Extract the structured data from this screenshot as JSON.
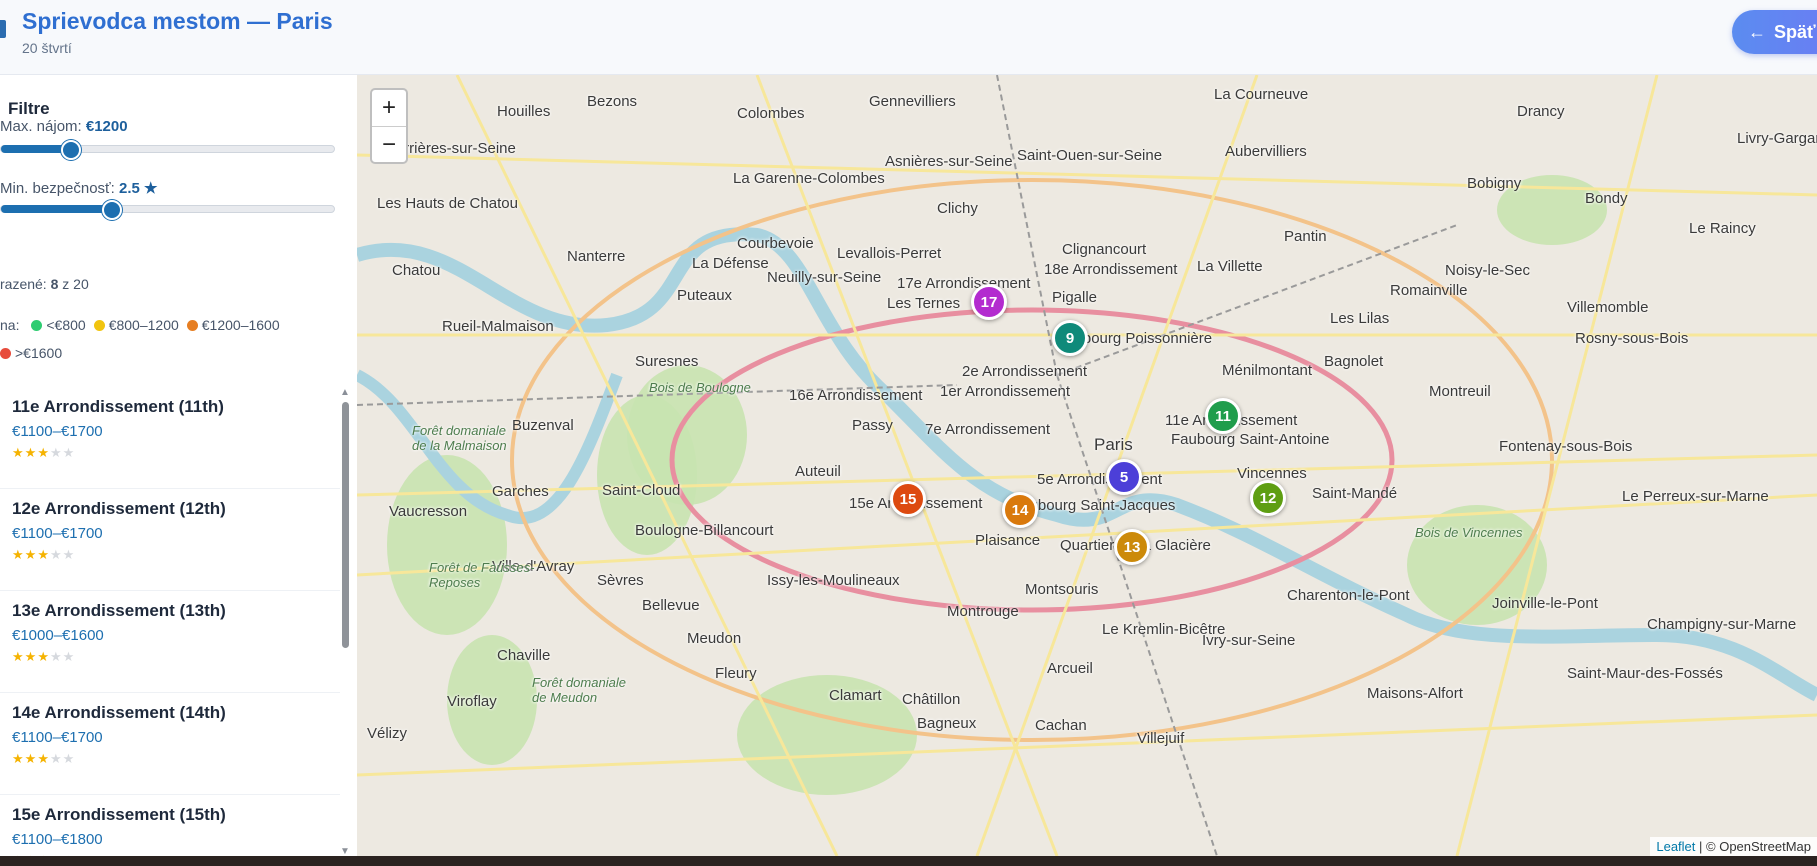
{
  "header": {
    "title": "Sprievodca mestom — Paris",
    "subtitle": "20 štvrtí",
    "back_label": "Späť"
  },
  "filters": {
    "title": "Filtre",
    "rent_label": "Max. nájom:",
    "rent_value": "€1200",
    "rent_fraction": 0.21,
    "safety_label": "Min. bezpečnosť:",
    "safety_value": "2.5 ★",
    "safety_fraction": 0.33,
    "shown_label": "razené:",
    "shown_count": "8",
    "shown_total": "z 20"
  },
  "legend": {
    "prefix": "na:",
    "items": [
      {
        "label": "<€800",
        "color": "#2ecc71"
      },
      {
        "label": "€800–1200",
        "color": "#f1c40f"
      },
      {
        "label": "€1200–1600",
        "color": "#e67e22"
      },
      {
        "label": ">€1600",
        "color": "#e74c3c"
      }
    ]
  },
  "neighborhoods": [
    {
      "name": "11e Arrondissement (11th)",
      "price": "€1100–€1700",
      "rating": 3
    },
    {
      "name": "12e Arrondissement (12th)",
      "price": "€1100–€1700",
      "rating": 3
    },
    {
      "name": "13e Arrondissement (13th)",
      "price": "€1000–€1600",
      "rating": 3
    },
    {
      "name": "14e Arrondissement (14th)",
      "price": "€1100–€1700",
      "rating": 3
    },
    {
      "name": "15e Arrondissement (15th)",
      "price": "€1100–€1800",
      "rating": 3
    }
  ],
  "map": {
    "zoom_in": "+",
    "zoom_out": "−",
    "markers": [
      {
        "label": "17",
        "color": "#b32bcf"
      },
      {
        "label": "9",
        "color": "#0f8a7a"
      },
      {
        "label": "11",
        "color": "#1f9d4c"
      },
      {
        "label": "5",
        "color": "#4c3fd8"
      },
      {
        "label": "12",
        "color": "#5e9e12"
      },
      {
        "label": "15",
        "color": "#dd4a10"
      },
      {
        "label": "14",
        "color": "#d9790c"
      },
      {
        "label": "13",
        "color": "#cc8a0a"
      }
    ],
    "places": [
      "Houilles",
      "Bezons",
      "Colombes",
      "Gennevilliers",
      "La Courneuve",
      "Drancy",
      "Livry-Gargan",
      "Carrières-sur-Seine",
      "Asnières-sur-Seine",
      "Saint-Ouen-sur-Seine",
      "Aubervilliers",
      "Bobigny",
      "Bondy",
      "Le Raincy",
      "La Garenne-Colombes",
      "Clichy",
      "Pantin",
      "Noisy-le-Sec",
      "Les Hauts de Chatou",
      "Courbevoie",
      "Levallois-Perret",
      "Clignancourt",
      "La Villette",
      "Romainville",
      "Villemomble",
      "Nanterre",
      "La Défense",
      "17e Arrondissement",
      "18e Arrondissement",
      "Chatou",
      "Puteaux",
      "Neuilly-sur-Seine",
      "Les Ternes",
      "Pigalle",
      "Les Lilas",
      "Rosny-sous-Bois",
      "Rueil-Malmaison",
      "Faubourg Poissonnière",
      "Suresnes",
      "2e Arrondissement",
      "Ménilmontant",
      "Bagnolet",
      "1er Arrondissement",
      "16e Arrondissement",
      "Montreuil",
      "Passy",
      "7e Arrondissement",
      "Paris",
      "11e Arrondissement",
      "Faubourg Saint-Antoine",
      "Fontenay-sous-Bois",
      "Buzenval",
      "Auteuil",
      "5e Arrondissement",
      "Garches",
      "Saint-Cloud",
      "15e Arrondissement",
      "Faubourg Saint-Jacques",
      "Saint-Mandé",
      "Vincennes",
      "Le Perreux-sur-Marne",
      "Boulogne-Billancourt",
      "Plaisance",
      "Quartier de la Glacière",
      "Vaucresson",
      "Ville-d'Avray",
      "Sèvres",
      "Issy-les-Moulineaux",
      "Montsouris",
      "Charenton-le-Pont",
      "Joinville-le-Pont",
      "Champigny-sur-Marne",
      "Bellevue",
      "Montrouge",
      "Meudon",
      "Le Kremlin-Bicêtre",
      "Ivry-sur-Seine",
      "Chaville",
      "Arcueil",
      "Fleury",
      "Saint-Maur-des-Fossés",
      "Viroflay",
      "Clamart",
      "Châtillon",
      "Maisons-Alfort",
      "Bagneux",
      "Cachan",
      "Villejuif",
      "Vélizy"
    ],
    "parks": [
      "Bois de Boulogne",
      "Forêt domaniale de la Malmaison",
      "Forêt de Fausses-Reposes",
      "Forêt domaniale de Meudon",
      "Bois de Vincennes"
    ],
    "attribution_leaflet": "Leaflet",
    "attribution_rest": "| © OpenStreetMap"
  }
}
